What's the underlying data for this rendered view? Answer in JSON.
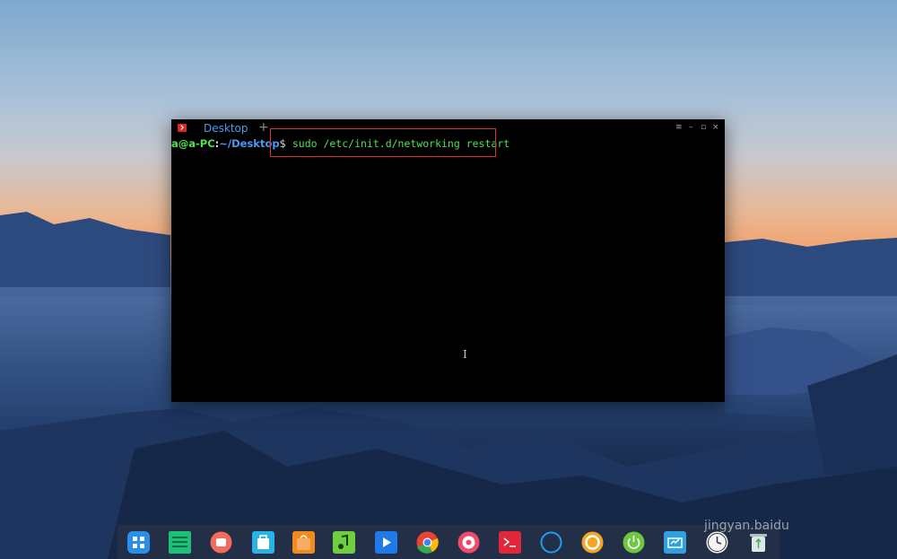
{
  "terminal": {
    "tab_label": "Desktop",
    "tab_add": "+",
    "controls": {
      "menu": "≡",
      "minimize": "–",
      "maximize": "▫",
      "close": "×"
    },
    "prompt_user_host": "a@a-PC",
    "prompt_colon": ":",
    "prompt_path": "~/Desktop",
    "prompt_dollar": "$",
    "command": " sudo /etc/init.d/networking restart",
    "text_cursor": "I"
  },
  "dock": {
    "items": [
      "launcher-icon",
      "file-manager-icon",
      "screen-recorder-icon",
      "app-store-icon",
      "shopping-bag-icon",
      "music-icon",
      "video-player-icon",
      "chrome-icon",
      "settings-icon",
      "terminal-icon",
      "system-monitor-icon",
      "browser-icon",
      "power-icon",
      "screenshot-icon",
      "clock-icon",
      "trash-icon"
    ]
  },
  "watermark": "jingyan.baidu"
}
